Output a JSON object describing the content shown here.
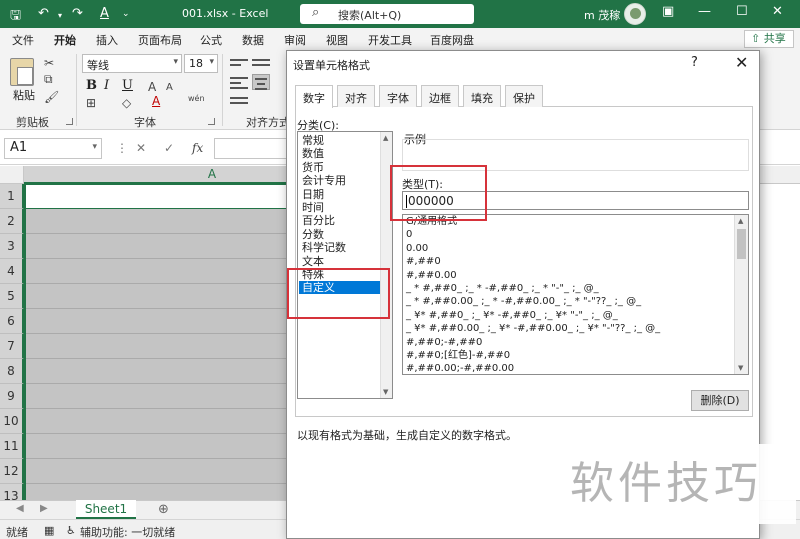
{
  "titlebar": {
    "filename": "001.xlsx  -  Excel",
    "search_placeholder": "搜索(Alt+Q)",
    "user": "m 茂稼",
    "bg_color": "#217346"
  },
  "ribbon_tabs": [
    "文件",
    "开始",
    "插入",
    "页面布局",
    "公式",
    "数据",
    "审阅",
    "视图",
    "开发工具",
    "百度网盘"
  ],
  "active_tab": "开始",
  "share_label": "共享",
  "ribbon": {
    "paste_label": "粘贴",
    "group_clipboard": "剪贴板",
    "group_font": "字体",
    "group_align": "对齐方式",
    "font_name": "等线",
    "font_size": "18",
    "bold": "B",
    "italic": "I",
    "underline": "U",
    "font_color_icon": "A",
    "wen_icon": "wén"
  },
  "formula_bar": {
    "name_box": "A1",
    "cancel_icon": "✕",
    "confirm_icon": "✓",
    "fx": "fx"
  },
  "grid": {
    "col_header": "A",
    "rows": [
      "1",
      "2",
      "3",
      "4",
      "5",
      "6",
      "7",
      "8",
      "9",
      "10",
      "11",
      "12",
      "13"
    ]
  },
  "sheet": {
    "tab": "Sheet1",
    "add_icon": "⊕"
  },
  "status": {
    "ready": "就绪",
    "accessibility": "辅助功能: 一切就绪"
  },
  "dialog": {
    "title": "设置单元格格式",
    "help": "?",
    "close": "✕",
    "tabs": [
      "数字",
      "对齐",
      "字体",
      "边框",
      "填充",
      "保护"
    ],
    "category_label": "分类(C):",
    "categories": [
      "常规",
      "数值",
      "货币",
      "会计专用",
      "日期",
      "时间",
      "百分比",
      "分数",
      "科学记数",
      "文本",
      "特殊",
      "自定义"
    ],
    "selected_category": "自定义",
    "example_label": "示例",
    "type_label": "类型(T):",
    "type_value": "000000",
    "formats": [
      "G/通用格式",
      "0",
      "0.00",
      "#,##0",
      "#,##0.00",
      "_ * #,##0_ ;_ * -#,##0_ ;_ * \"-\"_ ;_ @_",
      "_ * #,##0.00_ ;_ * -#,##0.00_ ;_ * \"-\"??_ ;_ @_",
      "_ ¥* #,##0_ ;_ ¥* -#,##0_ ;_ ¥* \"-\"_ ;_ @_",
      "_ ¥* #,##0.00_ ;_ ¥* -#,##0.00_ ;_ ¥* \"-\"??_ ;_ @_",
      "#,##0;-#,##0",
      "#,##0;[红色]-#,##0",
      "#,##0.00;-#,##0.00"
    ],
    "delete_label": "删除(D)",
    "description": "以现有格式为基础，生成自定义的数字格式。",
    "selection_color": "#0078d7",
    "annotation_color": "#d6323a"
  },
  "watermark": "软件技巧"
}
